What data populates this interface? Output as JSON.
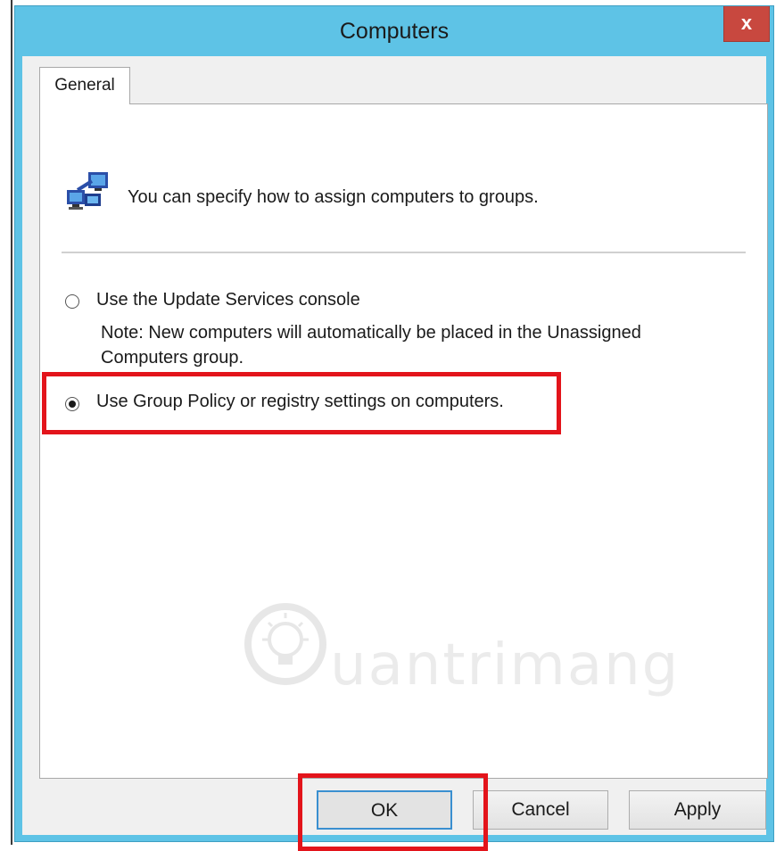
{
  "window": {
    "title": "Computers",
    "close_label": "x"
  },
  "tabs": [
    {
      "label": "General"
    }
  ],
  "header": {
    "icon": "computers-network-icon",
    "text": "You can specify how to assign computers to groups."
  },
  "options": [
    {
      "label": "Use the Update Services console",
      "selected": false,
      "note": "Note: New computers will automatically be placed in the Unassigned Computers group."
    },
    {
      "label": "Use Group Policy or registry settings on computers.",
      "selected": true
    }
  ],
  "watermark": {
    "text": "uantrimang",
    "icon": "lightbulb-icon"
  },
  "buttons": {
    "ok": "OK",
    "cancel": "Cancel",
    "apply": "Apply"
  },
  "colors": {
    "titlebar": "#5ec3e6",
    "close": "#c8483f",
    "highlight": "#e3141b"
  }
}
